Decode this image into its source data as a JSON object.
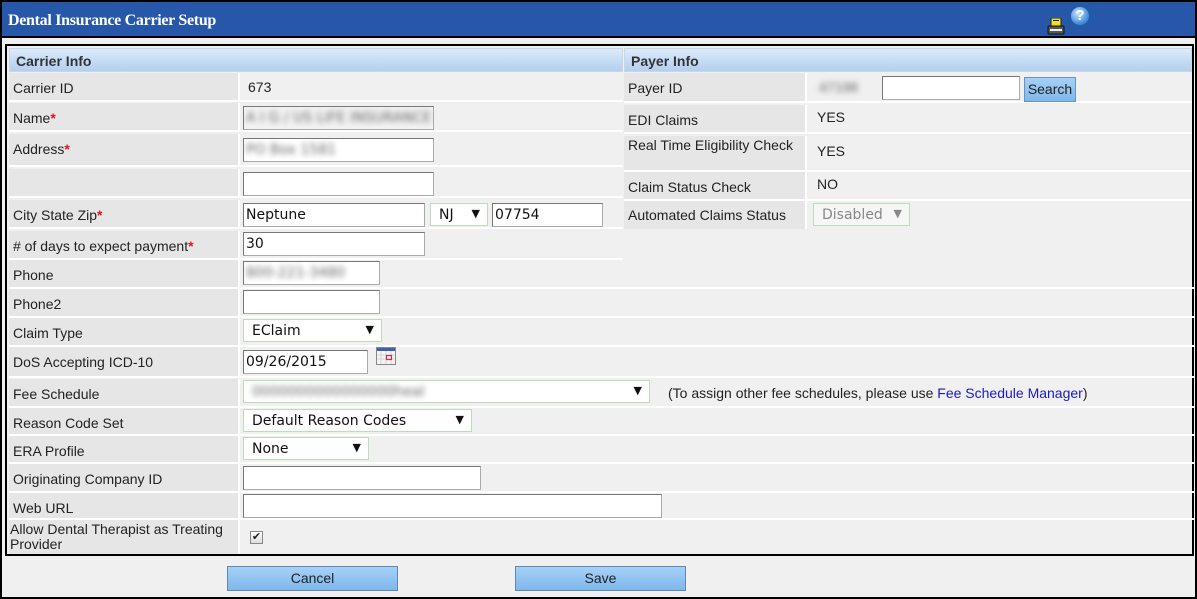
{
  "window": {
    "title": "Dental Insurance Carrier Setup",
    "icons": [
      "print-icon",
      "help-icon"
    ],
    "help_glyph": "?"
  },
  "carrier_info": {
    "header": "Carrier Info",
    "required_marker": "*",
    "carrier_id": {
      "label": "Carrier ID",
      "value": "673"
    },
    "name": {
      "label": "Name",
      "value": "A I G / US LIFE INSURANCE",
      "redacted": true
    },
    "address": {
      "label": "Address",
      "line1": "PO Box 1581",
      "line1_redacted": true,
      "line2": ""
    },
    "city_state_zip": {
      "label": "City State Zip",
      "city": "Neptune",
      "state": "NJ",
      "zip": "07754"
    },
    "days_to_payment": {
      "label": "# of days to expect payment",
      "value": "30"
    },
    "phone": {
      "label": "Phone",
      "value": "800-221-3480",
      "redacted": true
    },
    "phone2": {
      "label": "Phone2",
      "value": ""
    },
    "claim_type": {
      "label": "Claim Type",
      "selected": "EClaim"
    },
    "dos_icd10": {
      "label": "DoS Accepting ICD-10",
      "value": "09/26/2015",
      "icon": "calendar-icon"
    },
    "fee_schedule": {
      "label": "Fee Schedule",
      "selected": "0000000000000000heal",
      "redacted": true,
      "note_prefix": "(To assign other fee schedules, please use ",
      "note_link": "Fee Schedule Manager",
      "note_suffix": ")"
    },
    "reason_code_set": {
      "label": "Reason Code Set",
      "selected": "Default Reason Codes"
    },
    "era_profile": {
      "label": "ERA Profile",
      "selected": "None"
    },
    "originating_company_id": {
      "label": "Originating Company ID",
      "value": ""
    },
    "web_url": {
      "label": "Web URL",
      "value": ""
    },
    "allow_dental_therapist": {
      "label": "Allow Dental Therapist as Treating Provider",
      "checked": true,
      "check_glyph": "✔"
    }
  },
  "payer_info": {
    "header": "Payer Info",
    "payer_id": {
      "label": "Payer ID",
      "value": "47198",
      "redacted": true,
      "search_value": "",
      "search_button": "Search"
    },
    "edi_claims": {
      "label": "EDI Claims",
      "value": "YES"
    },
    "real_time_eligibility": {
      "label": "Real Time Eligibility Check",
      "value": "YES"
    },
    "claim_status_check": {
      "label": "Claim Status Check",
      "value": "NO"
    },
    "automated_claims_status": {
      "label": "Automated Claims Status",
      "selected": "Disabled"
    }
  },
  "footer": {
    "cancel_label": "Cancel",
    "save_label": "Save"
  },
  "dropdown_arrow": "▼"
}
